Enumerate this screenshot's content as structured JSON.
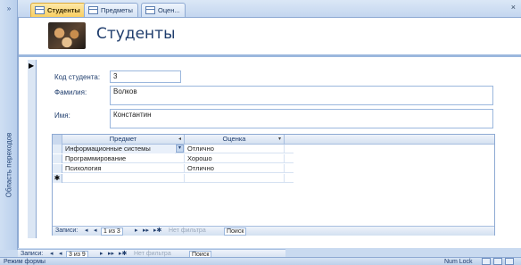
{
  "nav_pane": {
    "toggle": "»",
    "label": "Область переходов"
  },
  "tabs": [
    {
      "label": "Студенты",
      "active": true
    },
    {
      "label": "Предметы",
      "active": false
    },
    {
      "label": "Оцен...",
      "active": false
    }
  ],
  "tab_close": "×",
  "form": {
    "title": "Студенты",
    "record_selector": "▶",
    "fields": {
      "student_id": {
        "label": "Код студента:",
        "value": "3"
      },
      "last_name": {
        "label": "Фамилия:",
        "value": "Волков"
      },
      "first_name": {
        "label": "Имя:",
        "value": "Константин"
      }
    }
  },
  "subform": {
    "columns": [
      {
        "label": "Предмет"
      },
      {
        "label": "Оценка"
      }
    ],
    "rows": [
      {
        "subject": "Информационные системы",
        "grade": "Отлично",
        "selector": "",
        "combo": "▾"
      },
      {
        "subject": "Программирование",
        "grade": "Хорошо",
        "selector": ""
      },
      {
        "subject": "Психология",
        "grade": "Отлично",
        "selector": ""
      },
      {
        "subject": "",
        "grade": "",
        "selector": "✱"
      }
    ],
    "nav": {
      "label": "Записи:",
      "first": "◂",
      "prev": "◂",
      "position": "1 из 3",
      "next": "▸",
      "last": "▸▸",
      "new": "▸✱",
      "filter": "Нет фильтра",
      "search": "Поиск"
    }
  },
  "main_nav": {
    "label": "Записи:",
    "first": "◂",
    "prev": "◂",
    "position": "3 из 9",
    "next": "▸",
    "last": "▸▸",
    "new": "▸✱",
    "filter": "Нет фильтра",
    "search": "Поиск"
  },
  "status": {
    "mode": "Режим формы",
    "num_lock": "Num Lock"
  }
}
